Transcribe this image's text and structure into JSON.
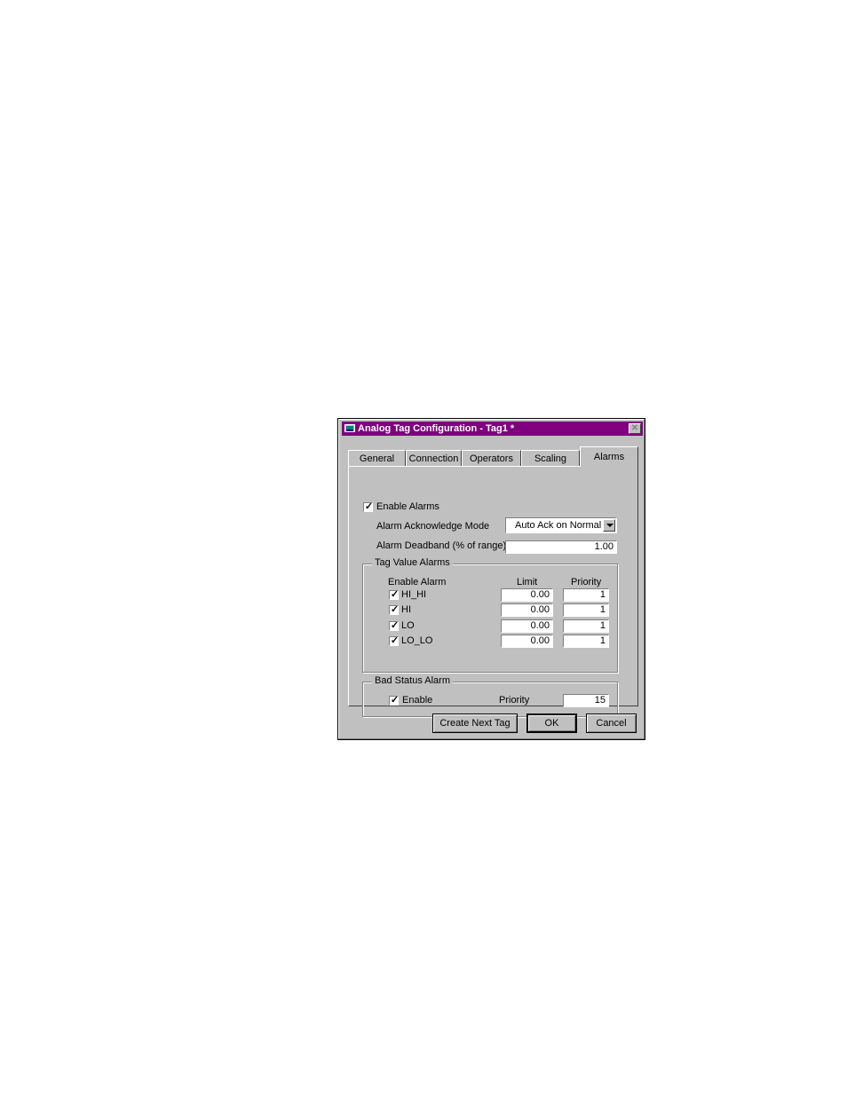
{
  "window": {
    "title": "Analog Tag Configuration - Tag1 *"
  },
  "tabs": [
    "General",
    "Connection",
    "Operators",
    "Scaling",
    "Alarms"
  ],
  "active_tab": "Alarms",
  "alarms": {
    "enable_alarms_label": "Enable Alarms",
    "enable_alarms_checked": true,
    "ack_mode_label": "Alarm Acknowledge Mode",
    "ack_mode_value": "Auto Ack on Normal",
    "deadband_label": "Alarm Deadband (% of range)",
    "deadband_value": "1.00"
  },
  "tag_value_alarms": {
    "group_title": "Tag Value Alarms",
    "col_enable": "Enable Alarm",
    "col_limit": "Limit",
    "col_priority": "Priority",
    "rows": [
      {
        "name": "HI_HI",
        "checked": true,
        "limit": "0.00",
        "priority": "1"
      },
      {
        "name": "HI",
        "checked": true,
        "limit": "0.00",
        "priority": "1"
      },
      {
        "name": "LO",
        "checked": true,
        "limit": "0.00",
        "priority": "1"
      },
      {
        "name": "LO_LO",
        "checked": true,
        "limit": "0.00",
        "priority": "1"
      }
    ]
  },
  "bad_status": {
    "group_title": "Bad Status Alarm",
    "enable_label": "Enable",
    "enable_checked": true,
    "priority_label": "Priority",
    "priority_value": "15"
  },
  "buttons": {
    "create_next": "Create Next Tag",
    "ok": "OK",
    "cancel": "Cancel"
  },
  "colors": {
    "titlebar": "#800080",
    "dialog_face": "#c0c0c0"
  },
  "icons": {
    "check": "✓",
    "close": "✕"
  }
}
